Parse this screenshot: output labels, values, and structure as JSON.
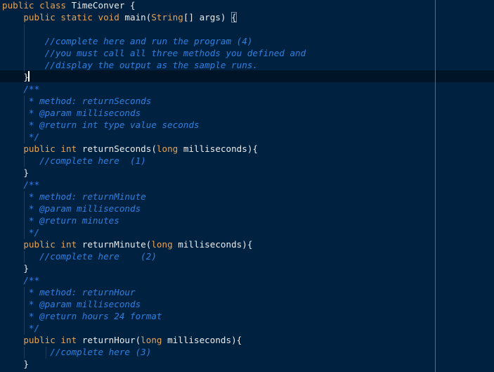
{
  "editor": {
    "language": "java",
    "current_line_index": 6,
    "lines": [
      {
        "indent": 0,
        "tokens": [
          {
            "t": "kw",
            "v": "public class "
          },
          {
            "t": "id",
            "v": "TimeConver "
          },
          {
            "t": "pn",
            "v": "{"
          }
        ]
      },
      {
        "indent": 1,
        "tokens": [
          {
            "t": "kw",
            "v": "public static void "
          },
          {
            "t": "id",
            "v": "main("
          },
          {
            "t": "ty",
            "v": "String"
          },
          {
            "t": "id",
            "v": "[] args) "
          },
          {
            "t": "pn",
            "v": "{",
            "match": true
          }
        ]
      },
      {
        "indent": 0,
        "tokens": []
      },
      {
        "indent": 2,
        "tokens": [
          {
            "t": "cm",
            "v": "//complete here and run the program (4)"
          }
        ]
      },
      {
        "indent": 2,
        "tokens": [
          {
            "t": "cm",
            "v": "//you must call all three methods you defined and"
          }
        ]
      },
      {
        "indent": 2,
        "tokens": [
          {
            "t": "cm",
            "v": "//display the output as the sample runs."
          }
        ]
      },
      {
        "indent": 1,
        "tokens": [
          {
            "t": "pn",
            "v": "}"
          }
        ]
      },
      {
        "indent": 1,
        "tokens": [
          {
            "t": "cm",
            "v": "/**"
          }
        ]
      },
      {
        "indent": 1,
        "tokens": [
          {
            "t": "cm",
            "v": " * method: returnSeconds"
          }
        ]
      },
      {
        "indent": 1,
        "tokens": [
          {
            "t": "cm",
            "v": " * @param milliseconds"
          }
        ]
      },
      {
        "indent": 1,
        "tokens": [
          {
            "t": "cm",
            "v": " * @return int type value seconds"
          }
        ]
      },
      {
        "indent": 1,
        "tokens": [
          {
            "t": "cm",
            "v": " */"
          }
        ]
      },
      {
        "indent": 1,
        "tokens": [
          {
            "t": "kw",
            "v": "public int "
          },
          {
            "t": "id",
            "v": "returnSeconds("
          },
          {
            "t": "kw",
            "v": "long "
          },
          {
            "t": "id",
            "v": "milliseconds){"
          }
        ]
      },
      {
        "indent": 1,
        "tokens": [
          {
            "t": "cm",
            "v": "   //complete here  (1)"
          }
        ]
      },
      {
        "indent": 1,
        "tokens": [
          {
            "t": "pn",
            "v": "}"
          }
        ]
      },
      {
        "indent": 1,
        "tokens": [
          {
            "t": "cm",
            "v": "/**"
          }
        ]
      },
      {
        "indent": 1,
        "tokens": [
          {
            "t": "cm",
            "v": " * method: returnMinute"
          }
        ]
      },
      {
        "indent": 1,
        "tokens": [
          {
            "t": "cm",
            "v": " * @param milliseconds"
          }
        ]
      },
      {
        "indent": 1,
        "tokens": [
          {
            "t": "cm",
            "v": " * @return minutes"
          }
        ]
      },
      {
        "indent": 1,
        "tokens": [
          {
            "t": "cm",
            "v": " */"
          }
        ]
      },
      {
        "indent": 1,
        "tokens": [
          {
            "t": "kw",
            "v": "public int "
          },
          {
            "t": "id",
            "v": "returnMinute("
          },
          {
            "t": "kw",
            "v": "long "
          },
          {
            "t": "id",
            "v": "milliseconds){"
          }
        ]
      },
      {
        "indent": 1,
        "tokens": [
          {
            "t": "cm",
            "v": "   //complete here    (2)"
          }
        ]
      },
      {
        "indent": 1,
        "tokens": [
          {
            "t": "pn",
            "v": "}"
          }
        ]
      },
      {
        "indent": 1,
        "tokens": [
          {
            "t": "cm",
            "v": "/**"
          }
        ]
      },
      {
        "indent": 1,
        "tokens": [
          {
            "t": "cm",
            "v": " * method: returnHour"
          }
        ]
      },
      {
        "indent": 1,
        "tokens": [
          {
            "t": "cm",
            "v": " * @param milliseconds"
          }
        ]
      },
      {
        "indent": 1,
        "tokens": [
          {
            "t": "cm",
            "v": " * @return hours 24 format"
          }
        ]
      },
      {
        "indent": 1,
        "tokens": [
          {
            "t": "cm",
            "v": " */"
          }
        ]
      },
      {
        "indent": 1,
        "tokens": [
          {
            "t": "kw",
            "v": "public int "
          },
          {
            "t": "id",
            "v": "returnHour("
          },
          {
            "t": "kw",
            "v": "long "
          },
          {
            "t": "id",
            "v": "milliseconds){"
          }
        ]
      },
      {
        "indent": 1,
        "tokens": [
          {
            "t": "cm",
            "v": "     //complete here (3)"
          }
        ]
      },
      {
        "indent": 1,
        "tokens": [
          {
            "t": "pn",
            "v": "}"
          }
        ]
      }
    ]
  },
  "colors": {
    "background": "#002240",
    "keyword": "#e8a253",
    "identifier": "#ebebeb",
    "comment": "#2f7fe0",
    "current_line": "#001428"
  }
}
